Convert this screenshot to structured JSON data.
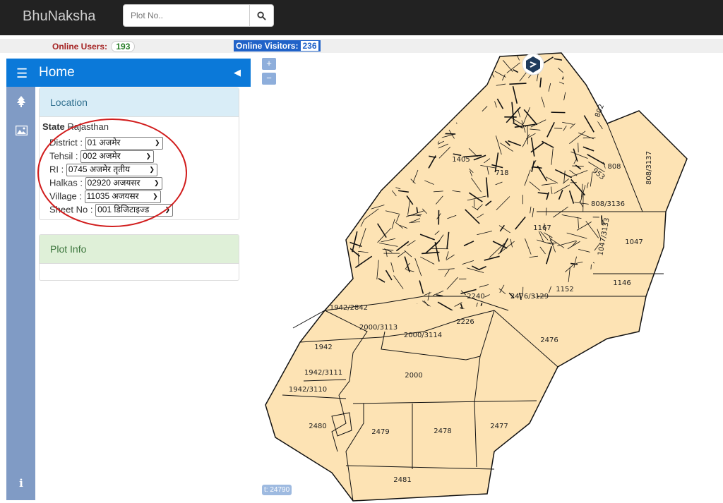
{
  "app": {
    "brand": "BhuNaksha"
  },
  "search": {
    "placeholder": "Plot No..",
    "icon": "search-icon"
  },
  "stats": {
    "users_label": "Online Users:",
    "users_count": "193",
    "visitors_label": "Online Visitors:",
    "visitors_count": "236"
  },
  "sidebar": {
    "title": "Home",
    "rail_icons": [
      "tree-icon",
      "image-icon",
      "info-icon"
    ]
  },
  "location": {
    "title": "Location",
    "state_label": "State",
    "state_value": "Rajasthan",
    "fields": [
      {
        "label": "District :",
        "value": "01 अजमेर"
      },
      {
        "label": "Tehsil :",
        "value": "002 अजमेर"
      },
      {
        "label": "RI :",
        "value": "0745 अजमेर तृतीय"
      },
      {
        "label": "Halkas :",
        "value": "02920 अजयसर"
      },
      {
        "label": "Village :",
        "value": "11035 अजयसर"
      },
      {
        "label": "Sheet No :",
        "value": "001 डिजिटाइज्ड"
      }
    ]
  },
  "plot_info": {
    "title": "Plot Info"
  },
  "map": {
    "fill_color": "#fde3b4",
    "annotation_color": "#d11c1c",
    "zoom_in": "+",
    "zoom_out": "−",
    "coord_text": "t: 24790",
    "plot_labels": [
      "808",
      "808/3137",
      "808/3136",
      "1047/3133",
      "1047",
      "1146",
      "1167",
      "1152",
      "2476/3129",
      "2240",
      "2226",
      "1942/2842",
      "2000/3113",
      "2000/3114",
      "2476",
      "1942",
      "1942/3111",
      "1942/3110",
      "2000",
      "2480",
      "2479",
      "2478",
      "2477",
      "2481",
      "1405",
      "718",
      "802",
      "953"
    ]
  }
}
